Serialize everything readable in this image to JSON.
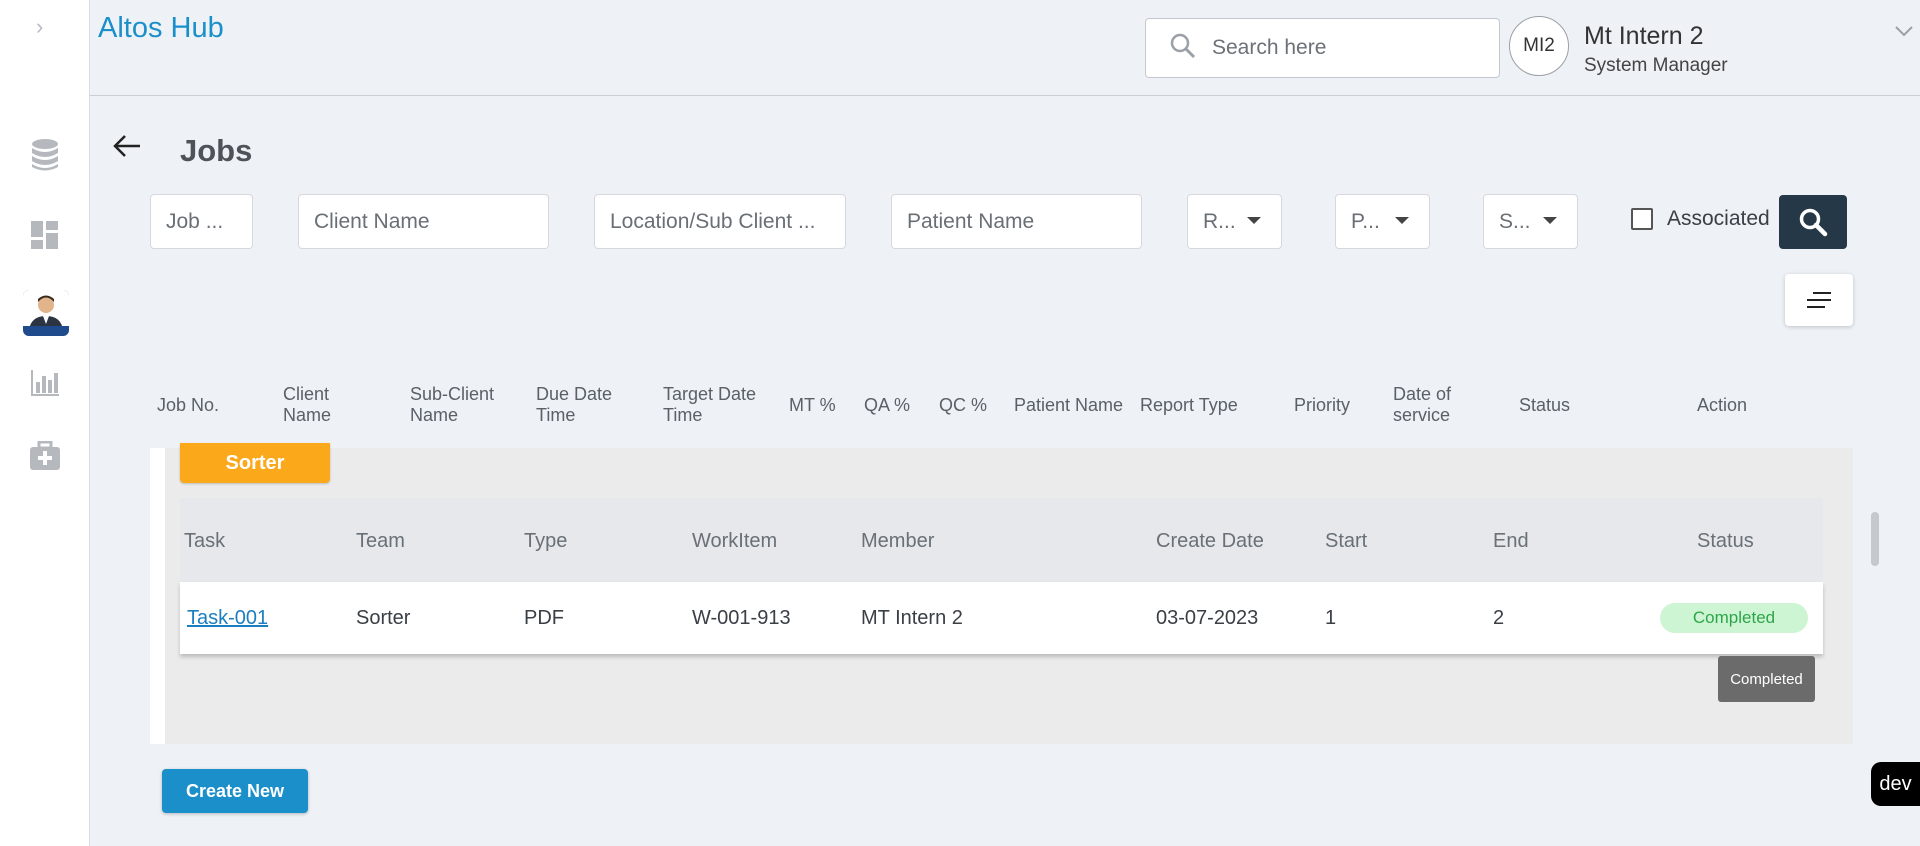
{
  "app": {
    "title": "Altos Hub"
  },
  "search": {
    "placeholder": "Search here"
  },
  "user": {
    "initials": "MI2",
    "name": "Mt Intern 2",
    "role": "System Manager"
  },
  "page": {
    "title": "Jobs"
  },
  "filters": {
    "job_no": "Job ...",
    "client_name": "Client Name",
    "location": "Location/Sub Client ...",
    "patient_name": "Patient Name",
    "report_type": "R...",
    "priority": "P...",
    "status": "S...",
    "associated_label": "Associated"
  },
  "columns": [
    "Job No.",
    "Client Name",
    "Sub-Client Name",
    "Due Date Time",
    "Target Date Time",
    "MT %",
    "QA %",
    "QC %",
    "Patient Name",
    "Report Type",
    "Priority",
    "Date of service",
    "Status",
    "Action"
  ],
  "sorter": {
    "label": "Sorter"
  },
  "subtable": {
    "headers": [
      "Task",
      "Team",
      "Type",
      "WorkItem",
      "Member",
      "Create Date",
      "Start",
      "End",
      "Status"
    ],
    "rows": [
      {
        "task": "Task-001",
        "team": "Sorter",
        "type": "PDF",
        "workitem": "W-001-913",
        "member": "MT Intern 2",
        "create_date": "03-07-2023",
        "start": "1",
        "end": "2",
        "status": "Completed"
      }
    ]
  },
  "tooltip": {
    "text": "Completed"
  },
  "actions": {
    "create_new": "Create New"
  },
  "env_badge": "dev",
  "colors": {
    "brand": "#1b8fc9",
    "sorter": "#fba81a",
    "dark_button": "#253847",
    "success_bg": "#cdf5d3",
    "success_text": "#2fa54a"
  }
}
